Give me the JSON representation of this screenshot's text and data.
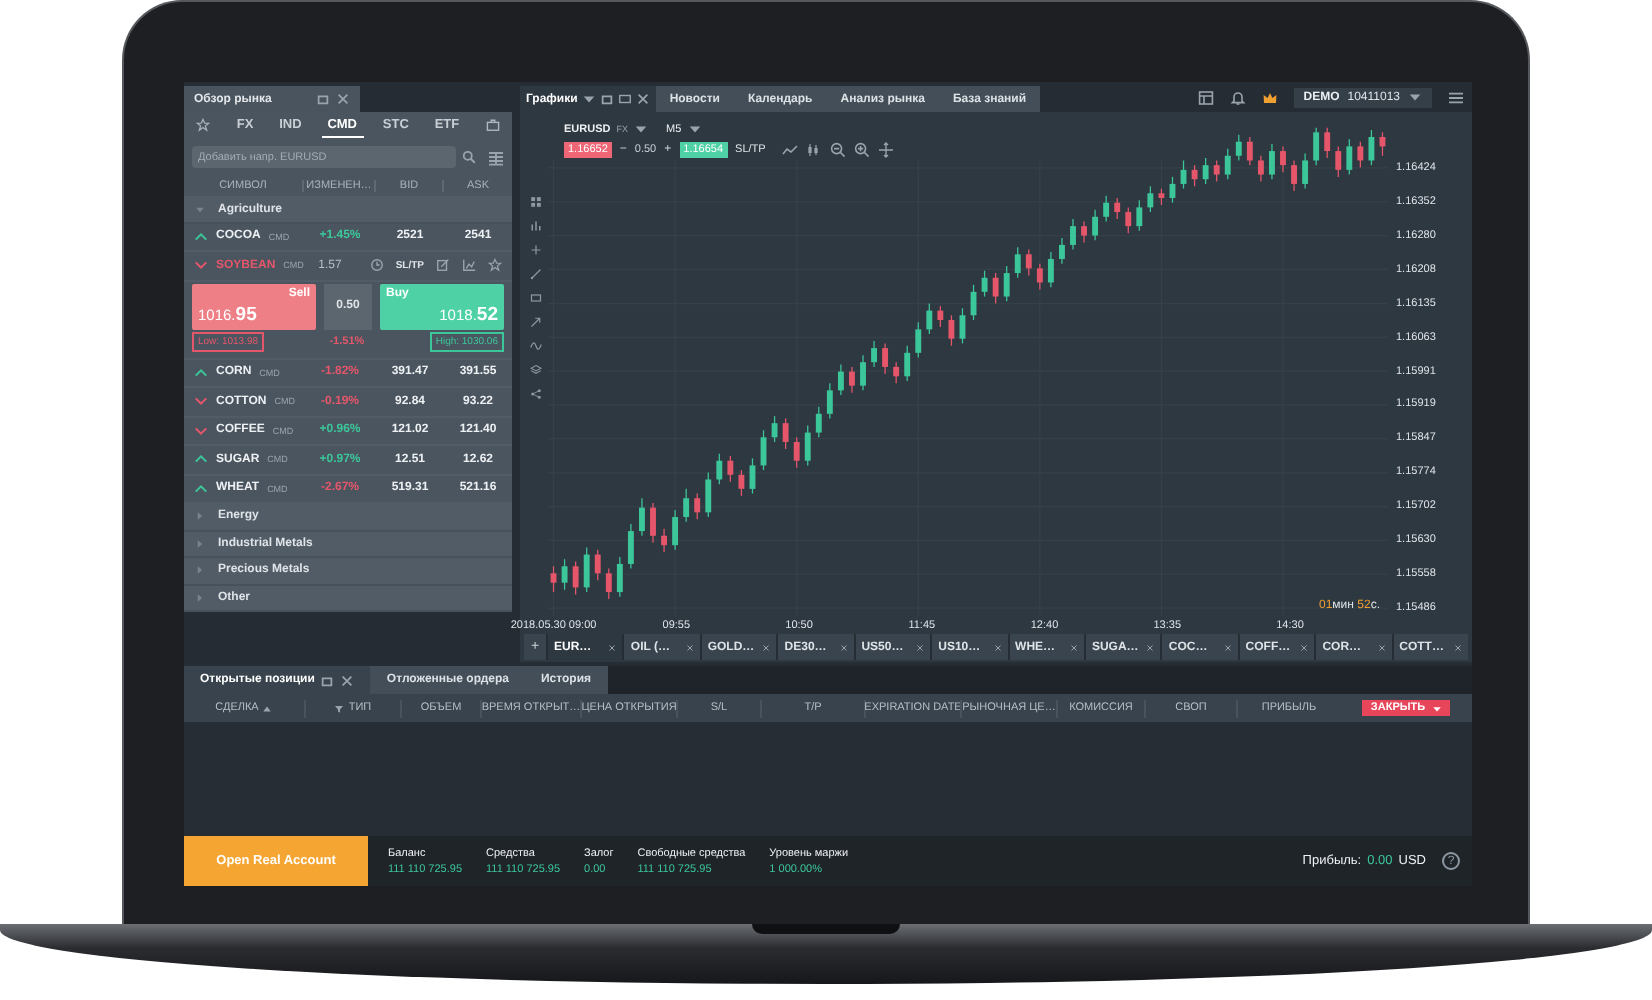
{
  "top_bar": {
    "tabs": [
      {
        "label": "Графики",
        "selected": true
      },
      {
        "label": "Новости",
        "selected": false
      },
      {
        "label": "Календарь",
        "selected": false
      },
      {
        "label": "Анализ рынка",
        "selected": false
      },
      {
        "label": "База знаний",
        "selected": false
      }
    ],
    "account": {
      "mode": "DEMO",
      "number": "10411013"
    }
  },
  "market_watch": {
    "title": "Обзор рынка",
    "categories": [
      {
        "kind": "star",
        "selected": false
      },
      {
        "kind": "label",
        "label": "FX",
        "selected": false
      },
      {
        "kind": "label",
        "label": "IND",
        "selected": false
      },
      {
        "kind": "label",
        "label": "CMD",
        "selected": true
      },
      {
        "kind": "label",
        "label": "STC",
        "selected": false
      },
      {
        "kind": "label",
        "label": "ETF",
        "selected": false
      },
      {
        "kind": "briefcase",
        "selected": false
      }
    ],
    "search": {
      "placeholder": "Добавить напр. EURUSD"
    },
    "columns": [
      "СИМВОЛ",
      "ИЗМЕНЕН…",
      "BID",
      "ASK"
    ],
    "groups": [
      {
        "name": "Agriculture",
        "expanded": true,
        "children": [
          {
            "symbol": "COCOA",
            "tag": "CMD",
            "trend_up": true,
            "expanded": false,
            "change": "+1.45%",
            "change_up": true,
            "bid": "2521",
            "ask": "2541"
          },
          {
            "symbol": "SOYBEAN",
            "tag": "CMD",
            "trend_up": false,
            "expanded": true,
            "value": "1.57",
            "sltp": "SL/TP",
            "sell": {
              "label": "Sell",
              "price": "1016.**95**",
              "low": "Low: 1013.98"
            },
            "spread": "0.50",
            "change": "-1.51%",
            "change_up": false,
            "buy": {
              "label": "Buy",
              "price": "1018.**52**",
              "high": "High: 1030.06"
            }
          },
          {
            "symbol": "CORN",
            "tag": "CMD",
            "trend_up": true,
            "expanded": false,
            "change": "-1.82%",
            "change_up": false,
            "bid": "391.47",
            "ask": "391.55"
          },
          {
            "symbol": "COTTON",
            "tag": "CMD",
            "trend_up": false,
            "expanded": false,
            "change": "-0.19%",
            "change_up": false,
            "bid": "92.84",
            "ask": "93.22"
          },
          {
            "symbol": "COFFEE",
            "tag": "CMD",
            "trend_up": false,
            "expanded": false,
            "change": "+0.96%",
            "change_up": true,
            "bid": "121.02",
            "ask": "121.40"
          },
          {
            "symbol": "SUGAR",
            "tag": "CMD",
            "trend_up": true,
            "expanded": false,
            "change": "+0.97%",
            "change_up": true,
            "bid": "12.51",
            "ask": "12.62"
          },
          {
            "symbol": "WHEAT",
            "tag": "CMD",
            "trend_up": true,
            "expanded": false,
            "change": "-2.67%",
            "change_up": false,
            "bid": "519.31",
            "ask": "521.16"
          }
        ]
      },
      {
        "name": "Energy",
        "expanded": false
      },
      {
        "name": "Industrial Metals",
        "expanded": false
      },
      {
        "name": "Precious Metals",
        "expanded": false
      },
      {
        "name": "Other",
        "expanded": false
      }
    ]
  },
  "chart": {
    "symbol": "EURUSD",
    "market": "FX",
    "timeframe": "M5",
    "sell_price": "1.16652",
    "minus": "−",
    "spread": "0.50",
    "plus": "+",
    "buy_price": "1.16654",
    "sltp": "SL/TP",
    "chart_data": {
      "type": "candlestick",
      "grid": true,
      "x": [
        540,
        545,
        550,
        555,
        560,
        565,
        570,
        575,
        580,
        585,
        590,
        595,
        600,
        605,
        610,
        615,
        620,
        625,
        630,
        635,
        640,
        645,
        650,
        655,
        660,
        665,
        670,
        675,
        680,
        685,
        690,
        695,
        700,
        705,
        710,
        715,
        720,
        725,
        730,
        735,
        740,
        745,
        750,
        755,
        760,
        765,
        770,
        775,
        780,
        785,
        790,
        795,
        800,
        805,
        810,
        815,
        820,
        825,
        830,
        835,
        840,
        845,
        850,
        855,
        860,
        865,
        870,
        875,
        880,
        885,
        890,
        895,
        900,
        905,
        910,
        915
      ],
      "ohlc": [
        [
          1.1556,
          1.15575,
          1.1552,
          1.1554
        ],
        [
          1.1554,
          1.1559,
          1.15525,
          1.15575
        ],
        [
          1.15575,
          1.15585,
          1.15515,
          1.1553
        ],
        [
          1.1553,
          1.15615,
          1.1552,
          1.156
        ],
        [
          1.156,
          1.1561,
          1.15545,
          1.1556
        ],
        [
          1.1556,
          1.1557,
          1.15505,
          1.1552
        ],
        [
          1.1552,
          1.15595,
          1.1551,
          1.1558
        ],
        [
          1.1558,
          1.15665,
          1.1557,
          1.1565
        ],
        [
          1.1565,
          1.1572,
          1.1564,
          1.157
        ],
        [
          1.157,
          1.1571,
          1.15625,
          1.1564
        ],
        [
          1.1564,
          1.15655,
          1.15605,
          1.1562
        ],
        [
          1.1562,
          1.15695,
          1.1561,
          1.1568
        ],
        [
          1.1568,
          1.1574,
          1.1567,
          1.1572
        ],
        [
          1.1572,
          1.1573,
          1.15675,
          1.1569
        ],
        [
          1.1569,
          1.15775,
          1.1568,
          1.1576
        ],
        [
          1.1576,
          1.15815,
          1.1575,
          1.158
        ],
        [
          1.158,
          1.1581,
          1.15755,
          1.1577
        ],
        [
          1.1577,
          1.1578,
          1.15725,
          1.1574
        ],
        [
          1.1574,
          1.15805,
          1.1573,
          1.1579
        ],
        [
          1.1579,
          1.15865,
          1.1578,
          1.1585
        ],
        [
          1.1585,
          1.15895,
          1.1584,
          1.1588
        ],
        [
          1.1588,
          1.1589,
          1.15825,
          1.1584
        ],
        [
          1.1584,
          1.1585,
          1.15785,
          1.158
        ],
        [
          1.158,
          1.15875,
          1.1579,
          1.1586
        ],
        [
          1.1586,
          1.15915,
          1.1585,
          1.159
        ],
        [
          1.159,
          1.15965,
          1.1589,
          1.1595
        ],
        [
          1.1595,
          1.16005,
          1.1594,
          1.1599
        ],
        [
          1.1599,
          1.16,
          1.15945,
          1.1596
        ],
        [
          1.1596,
          1.16025,
          1.1595,
          1.1601
        ],
        [
          1.1601,
          1.16055,
          1.16,
          1.1604
        ],
        [
          1.1604,
          1.1605,
          1.15985,
          1.16
        ],
        [
          1.16,
          1.1601,
          1.15965,
          1.1598
        ],
        [
          1.1598,
          1.16045,
          1.1597,
          1.1603
        ],
        [
          1.1603,
          1.16095,
          1.1602,
          1.1608
        ],
        [
          1.1608,
          1.16135,
          1.1607,
          1.1612
        ],
        [
          1.1612,
          1.1613,
          1.16085,
          1.161
        ],
        [
          1.161,
          1.1611,
          1.16045,
          1.1606
        ],
        [
          1.1606,
          1.16125,
          1.1605,
          1.1611
        ],
        [
          1.1611,
          1.16175,
          1.161,
          1.1616
        ],
        [
          1.1616,
          1.16205,
          1.1615,
          1.1619
        ],
        [
          1.1619,
          1.162,
          1.16135,
          1.1615
        ],
        [
          1.1615,
          1.16215,
          1.1614,
          1.162
        ],
        [
          1.162,
          1.16255,
          1.1619,
          1.1624
        ],
        [
          1.1624,
          1.1625,
          1.16195,
          1.1621
        ],
        [
          1.1621,
          1.1622,
          1.16165,
          1.1618
        ],
        [
          1.1618,
          1.16245,
          1.1617,
          1.1623
        ],
        [
          1.1623,
          1.16275,
          1.1622,
          1.1626
        ],
        [
          1.1626,
          1.16315,
          1.1625,
          1.163
        ],
        [
          1.163,
          1.1631,
          1.16265,
          1.1628
        ],
        [
          1.1628,
          1.16335,
          1.1627,
          1.1632
        ],
        [
          1.1632,
          1.16365,
          1.1631,
          1.1635
        ],
        [
          1.1635,
          1.1636,
          1.16315,
          1.1633
        ],
        [
          1.1633,
          1.1634,
          1.16285,
          1.163
        ],
        [
          1.163,
          1.16355,
          1.1629,
          1.1634
        ],
        [
          1.1634,
          1.16385,
          1.1633,
          1.1637
        ],
        [
          1.1637,
          1.1638,
          1.16345,
          1.1636
        ],
        [
          1.1636,
          1.16405,
          1.1635,
          1.1639
        ],
        [
          1.1639,
          1.1644,
          1.1638,
          1.1642
        ],
        [
          1.1642,
          1.1643,
          1.16385,
          1.164
        ],
        [
          1.164,
          1.16445,
          1.1639,
          1.1643
        ],
        [
          1.1643,
          1.1644,
          1.16395,
          1.1641
        ],
        [
          1.1641,
          1.16465,
          1.164,
          1.1645
        ],
        [
          1.1645,
          1.16495,
          1.1644,
          1.1648
        ],
        [
          1.1648,
          1.1649,
          1.1643,
          1.1644
        ],
        [
          1.1644,
          1.1645,
          1.16395,
          1.1641
        ],
        [
          1.1641,
          1.16475,
          1.164,
          1.1646
        ],
        [
          1.1646,
          1.1647,
          1.16415,
          1.1643
        ],
        [
          1.1643,
          1.1644,
          1.16375,
          1.1639
        ],
        [
          1.1639,
          1.16455,
          1.1638,
          1.1644
        ],
        [
          1.1644,
          1.1651,
          1.1643,
          1.165
        ],
        [
          1.165,
          1.1651,
          1.16445,
          1.1646
        ],
        [
          1.1646,
          1.1647,
          1.16405,
          1.1642
        ],
        [
          1.1642,
          1.16485,
          1.1641,
          1.1647
        ],
        [
          1.1647,
          1.1648,
          1.16425,
          1.1644
        ],
        [
          1.1644,
          1.16505,
          1.1643,
          1.1649
        ],
        [
          1.1649,
          1.165,
          1.1645,
          1.1647
        ]
      ],
      "xlim": [
        537.5,
        917.5
      ],
      "ylim": [
        1.15469,
        1.16441
      ],
      "xticks": [
        {
          "value": 540,
          "label": "2018.05.30 09:00"
        },
        {
          "value": 595,
          "label": "09:55"
        },
        {
          "value": 650,
          "label": "10:50"
        },
        {
          "value": 705,
          "label": "11:45"
        },
        {
          "value": 760,
          "label": "12:40"
        },
        {
          "value": 815,
          "label": "13:35"
        },
        {
          "value": 870,
          "label": "14:30"
        }
      ],
      "yticks": [
        {
          "value": 1.16424,
          "label": "1.16424"
        },
        {
          "value": 1.16352,
          "label": "1.16352"
        },
        {
          "value": 1.1628,
          "label": "1.16280"
        },
        {
          "value": 1.16208,
          "label": "1.16208"
        },
        {
          "value": 1.16135,
          "label": "1.16135"
        },
        {
          "value": 1.16063,
          "label": "1.16063"
        },
        {
          "value": 1.15991,
          "label": "1.15991"
        },
        {
          "value": 1.15919,
          "label": "1.15919"
        },
        {
          "value": 1.15847,
          "label": "1.15847"
        },
        {
          "value": 1.15774,
          "label": "1.15774"
        },
        {
          "value": 1.15702,
          "label": "1.15702"
        },
        {
          "value": 1.1563,
          "label": "1.15630"
        },
        {
          "value": 1.15558,
          "label": "1.15558"
        },
        {
          "value": 1.15486,
          "label": "1.15486"
        }
      ]
    },
    "timer": {
      "minutes": "01",
      "minutes_unit": "мин",
      "seconds": "52",
      "seconds_unit": "с."
    },
    "add_tab": "+",
    "instrument_tabs": [
      {
        "label": "EUR…",
        "selected": true
      },
      {
        "label": "OIL (…",
        "selected": false
      },
      {
        "label": "GOLD…",
        "selected": false
      },
      {
        "label": "DE30…",
        "selected": false
      },
      {
        "label": "US50…",
        "selected": false
      },
      {
        "label": "US10…",
        "selected": false
      },
      {
        "label": "WHE…",
        "selected": false
      },
      {
        "label": "SUGA…",
        "selected": false
      },
      {
        "label": "COC…",
        "selected": false
      },
      {
        "label": "COFF…",
        "selected": false
      },
      {
        "label": "COR…",
        "selected": false
      },
      {
        "label": "COTT…",
        "selected": false
      }
    ]
  },
  "positions": {
    "tabs": [
      {
        "label": "Открытые позиции",
        "selected": true
      },
      {
        "label": "Отложенные ордера",
        "selected": false
      },
      {
        "label": "История",
        "selected": false
      }
    ],
    "columns": [
      {
        "label": "СДЕЛКА",
        "kind": "sorted"
      },
      {
        "label": "ТИП",
        "kind": "filter"
      },
      {
        "label": "ОБЪЕМ",
        "kind": "plain"
      },
      {
        "label": "ВРЕМЯ ОТКРЫТ…",
        "kind": "plain"
      },
      {
        "label": "ЦЕНА ОТКРЫТИЯ",
        "kind": "plain"
      },
      {
        "label": "S/L",
        "kind": "plain"
      },
      {
        "label": "T/P",
        "kind": "plain"
      },
      {
        "label": "EXPIRATION DATE",
        "kind": "plain"
      },
      {
        "label": "РЫНОЧНАЯ ЦЕ…",
        "kind": "plain"
      },
      {
        "label": "КОМИССИЯ",
        "kind": "plain"
      },
      {
        "label": "СВОП",
        "kind": "plain"
      },
      {
        "label": "ПРИБЫЛЬ",
        "kind": "plain"
      }
    ],
    "close_button": "ЗАКРЫТЬ"
  },
  "footer": {
    "open_account": "Open Real Account",
    "stats": [
      {
        "label": "Баланс",
        "value": "111 110 725.95"
      },
      {
        "label": "Средства",
        "value": "111 110 725.95"
      },
      {
        "label": "Залог",
        "value": "0.00"
      },
      {
        "label": "Свободные средства",
        "value": "111 110 725.95"
      },
      {
        "label": "Уровень маржи",
        "value": "1 000.00%"
      }
    ],
    "profit": {
      "label": "Прибыль:",
      "value": "0.00",
      "currency": "USD"
    },
    "help": "?"
  }
}
